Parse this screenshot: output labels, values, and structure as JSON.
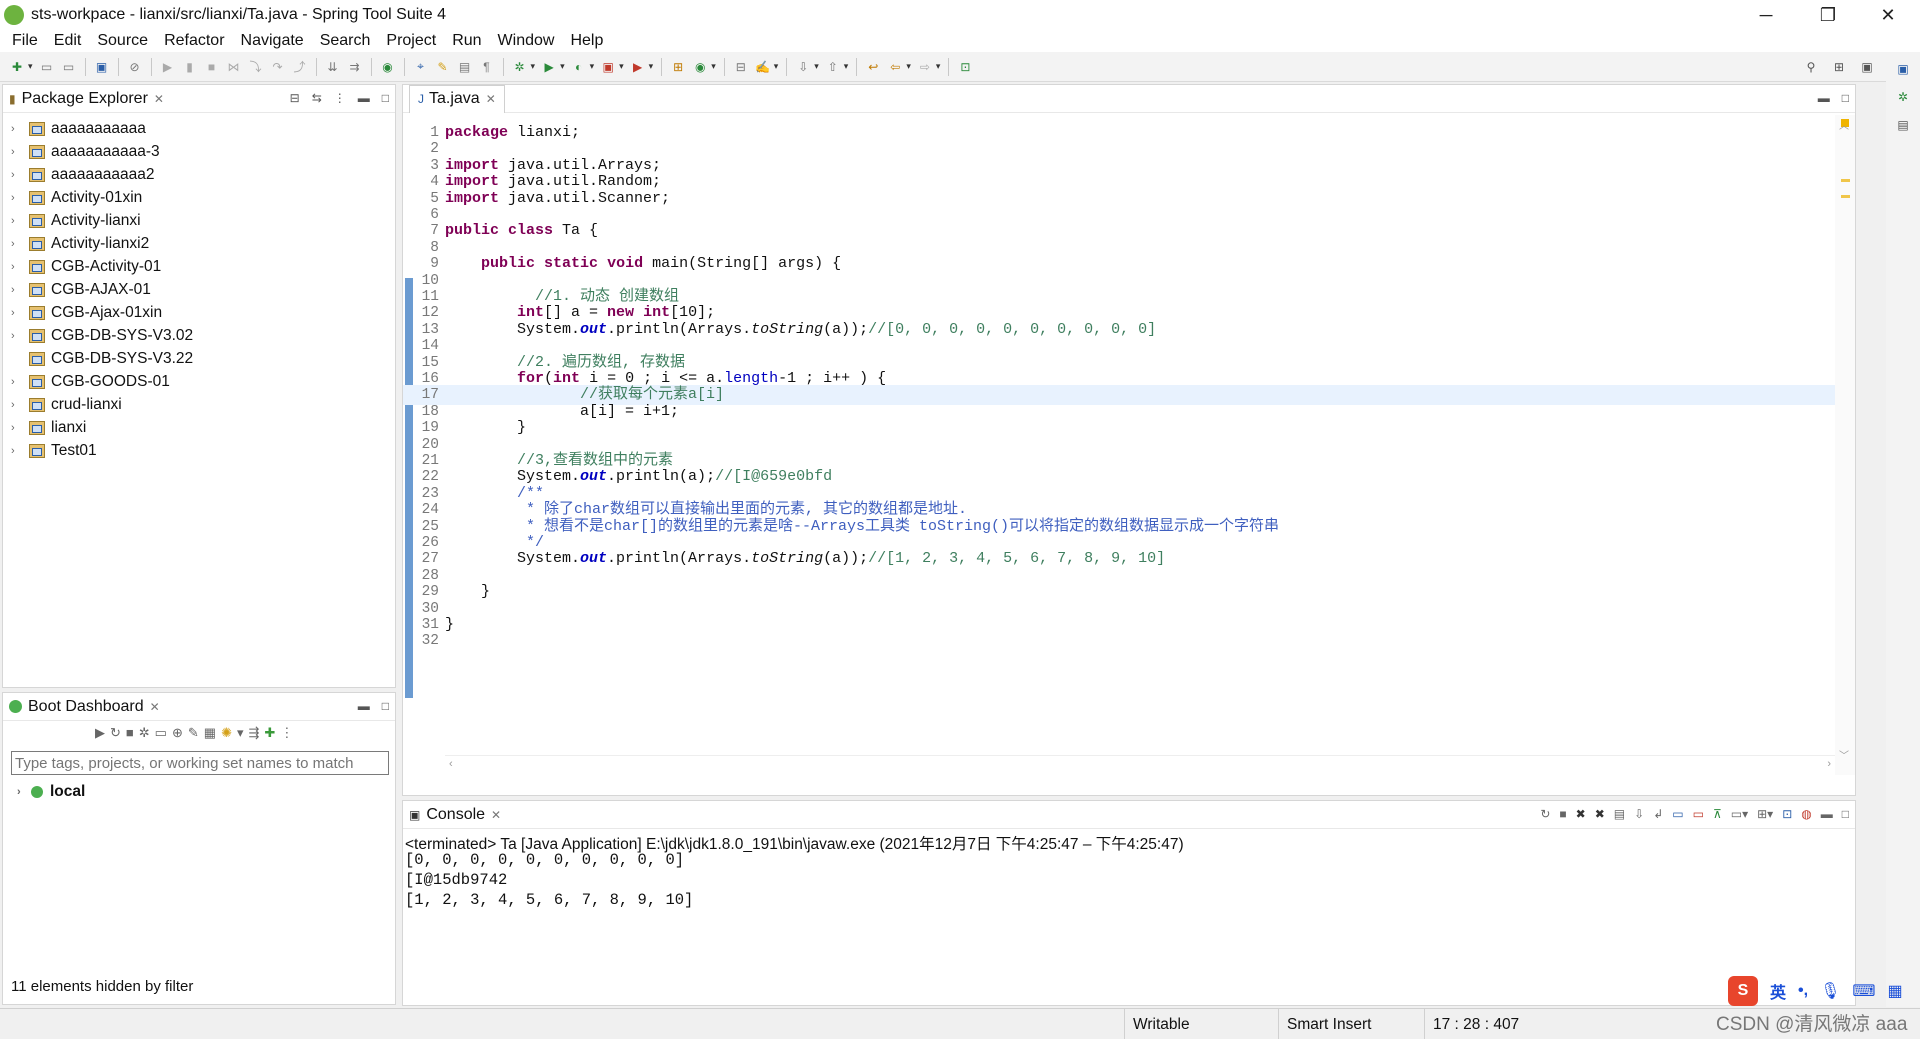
{
  "window": {
    "title": "sts-workpace - lianxi/src/lianxi/Ta.java - Spring Tool Suite 4",
    "minimize": "─",
    "restore": "❐",
    "close": "✕"
  },
  "menu": [
    "File",
    "Edit",
    "Source",
    "Refactor",
    "Navigate",
    "Search",
    "Project",
    "Run",
    "Window",
    "Help"
  ],
  "package_explorer": {
    "title": "Package Explorer",
    "projects": [
      "aaaaaaaaaaa",
      "aaaaaaaaaaa-3",
      "aaaaaaaaaaa2",
      "Activity-01xin",
      "Activity-lianxi",
      "Activity-lianxi2",
      "CGB-Activity-01",
      "CGB-AJAX-01",
      "CGB-Ajax-01xin",
      "CGB-DB-SYS-V3.02",
      "CGB-DB-SYS-V3.22",
      "CGB-GOODS-01",
      "crud-lianxi",
      "lianxi",
      "Test01"
    ]
  },
  "boot_dashboard": {
    "title": "Boot Dashboard",
    "filter_placeholder": "Type tags, projects, or working set names to match",
    "node": "local",
    "hidden_note": "11 elements hidden by filter"
  },
  "editor": {
    "tab": "Ta.java",
    "lines": [
      "package lianxi;",
      "",
      "import java.util.Arrays;",
      "import java.util.Random;",
      "import java.util.Scanner;",
      "",
      "public class Ta {",
      "",
      "    public static void main(String[] args) {",
      "",
      "          //1. 动态 创建数组",
      "        int[] a = new int[10];",
      "        System.out.println(Arrays.toString(a));//[0, 0, 0, 0, 0, 0, 0, 0, 0, 0]",
      "",
      "        //2. 遍历数组, 存数据",
      "        for(int i = 0 ; i <= a.length-1 ; i++ ) {",
      "               //获取每个元素a[i]",
      "               a[i] = i+1;",
      "        }",
      "",
      "        //3,查看数组中的元素",
      "        System.out.println(a);//[I@659e0bfd",
      "        /**",
      "         * 除了char数组可以直接输出里面的元素, 其它的数组都是地址.",
      "         * 想看不是char[]的数组里的元素是啥--Arrays工具类 toString()可以将指定的数组数据显示成一个字符串",
      "         */",
      "        System.out.println(Arrays.toString(a));//[1, 2, 3, 4, 5, 6, 7, 8, 9, 10]",
      "",
      "    }",
      "",
      "}",
      ""
    ]
  },
  "console": {
    "title": "Console",
    "terminated": "<terminated> Ta [Java Application] E:\\jdk\\jdk1.8.0_191\\bin\\javaw.exe  (2021年12月7日 下午4:25:47 – 下午4:25:47)",
    "output": [
      "[0, 0, 0, 0, 0, 0, 0, 0, 0, 0]",
      "[I@15db9742",
      "[1, 2, 3, 4, 5, 6, 7, 8, 9, 10]"
    ]
  },
  "status": {
    "writable": "Writable",
    "insert_mode": "Smart Insert",
    "position": "17 : 28 : 407"
  },
  "ime": {
    "lang": "英",
    "punct": "•,"
  },
  "watermark": "CSDN @清风微凉 aaa"
}
